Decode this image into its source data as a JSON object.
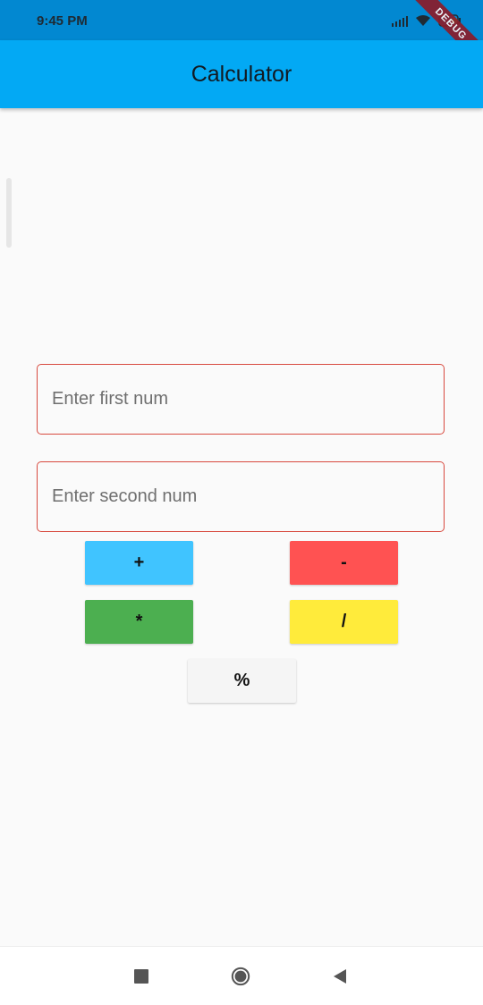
{
  "status_bar": {
    "time": "9:45 PM",
    "debug_label": "DEBUG",
    "icons": [
      "signal-icon",
      "wifi-icon",
      "battery-icon"
    ]
  },
  "app_bar": {
    "title": "Calculator"
  },
  "form": {
    "first_placeholder": "Enter first num",
    "second_placeholder": "Enter second num"
  },
  "buttons": {
    "add": {
      "label": "+",
      "color": "#40c4ff"
    },
    "subtract": {
      "label": "-",
      "color": "#ff5252"
    },
    "multiply": {
      "label": "*",
      "color": "#4caf50"
    },
    "divide": {
      "label": "/",
      "color": "#ffeb3b"
    },
    "modulo": {
      "label": "%",
      "color": "#f5f5f5"
    }
  },
  "colors": {
    "status_bar": "#0288d1",
    "app_bar": "#03a9f4",
    "field_border": "#d84a3f"
  },
  "nav": {
    "icons": [
      "recent-apps-icon",
      "home-icon",
      "back-icon"
    ]
  }
}
